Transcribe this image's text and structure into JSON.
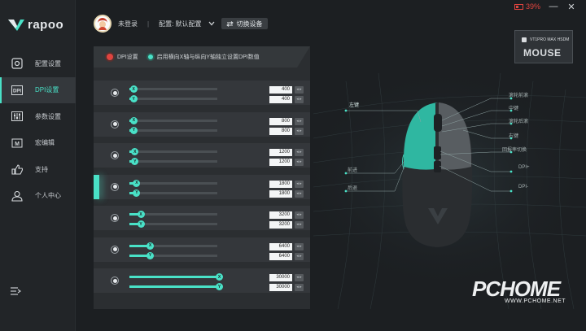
{
  "brand": {
    "logo_text": "rapoo"
  },
  "window": {
    "battery": "39%",
    "minimize": "—",
    "close": "✕"
  },
  "header": {
    "user": "未登录",
    "separator": "|",
    "config_label": "配置: 默认配置",
    "switch_device": "切换设备"
  },
  "device": {
    "name": "VT1PRO MAX HSDM",
    "logo": "MOUSE"
  },
  "sidebar": {
    "items": [
      {
        "label": "配置设置",
        "icon": "settings-icon"
      },
      {
        "label": "DPI设置",
        "icon": "dpi-icon",
        "active": true
      },
      {
        "label": "参数设置",
        "icon": "sliders-icon"
      },
      {
        "label": "宏编辑",
        "icon": "macro-icon"
      },
      {
        "label": "支持",
        "icon": "thumbs-up-icon"
      },
      {
        "label": "个人中心",
        "icon": "user-icon"
      }
    ]
  },
  "dpi_panel": {
    "dpi_setting_label": "DPI设置",
    "xy_label": "启用横向X轴与纵向Y轴独立设置DPI数值",
    "knob_x": "X",
    "knob_y": "Y",
    "stepper": "◂ ▸",
    "max_dpi": 30000,
    "rows": [
      {
        "x": "400",
        "y": "400",
        "x_value": 400,
        "y_value": 400
      },
      {
        "x": "800",
        "y": "800",
        "x_value": 800,
        "y_value": 800
      },
      {
        "x": "1200",
        "y": "1200",
        "x_value": 1200,
        "y_value": 1200
      },
      {
        "x": "1800",
        "y": "1800",
        "x_value": 1800,
        "y_value": 1800,
        "active": true
      },
      {
        "x": "3200",
        "y": "3200",
        "x_value": 3200,
        "y_value": 3200
      },
      {
        "x": "6400",
        "y": "6400",
        "x_value": 6400,
        "y_value": 6400
      },
      {
        "x": "30000",
        "y": "30000",
        "x_value": 30000,
        "y_value": 30000
      }
    ]
  },
  "mouse_labels": {
    "left_key": "左键",
    "scroll_forward": "滚轮前滚",
    "middle_key": "中键",
    "scroll_back": "滚轮后滚",
    "right_key": "右键",
    "rate_switch": "回报率切换",
    "forward": "前进",
    "back": "后退",
    "dpi_plus": "DPI+",
    "dpi_minus": "DPI-"
  },
  "watermark": {
    "main": "PCHOME",
    "sub": "WWW.PCHOME.NET"
  },
  "colors": {
    "accent": "#49e1c7",
    "alert": "#e0443f",
    "panel": "#2b2e31"
  }
}
